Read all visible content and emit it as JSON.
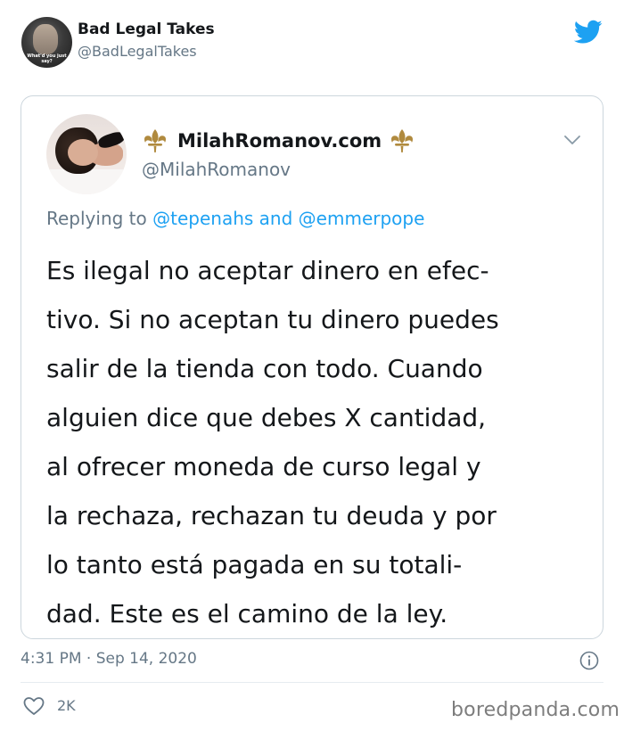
{
  "author": {
    "name": "Bad Legal Takes",
    "handle": "@BadLegalTakes",
    "avatar_caption": "What'd you just say?"
  },
  "quoted_tweet": {
    "display_name": "MilahRomanov.com",
    "handle": "@MilahRomanov",
    "replying_prefix": "Replying to",
    "mention_1": "@tepenahs",
    "replying_and": "and",
    "mention_2": "@emmerpope",
    "body_lines": [
      "Es ilegal no aceptar dinero en efec-",
      "tivo. Si no aceptan tu dinero puedes",
      "salir de la tienda con todo. Cuando",
      "alguien dice que debes X cantidad,",
      "al ofrecer moneda de curso legal y",
      "la rechaza, rechazan tu deuda y por",
      "lo tanto está pagada en su totali-",
      "dad. Este es el camino de la ley."
    ]
  },
  "footer": {
    "timestamp": "4:31 PM · Sep 14, 2020",
    "likes": "2K",
    "watermark": "boredpanda.com"
  },
  "icons": {
    "brand": "twitter-bird-icon",
    "decoration": "fleur-de-lis-icon",
    "menu": "chevron-down-icon",
    "info": "info-icon",
    "like": "heart-icon"
  },
  "colors": {
    "brand_blue": "#1da1f2",
    "muted_text": "#657786",
    "text": "#14171a",
    "border": "#ccd6dd",
    "fleur_gold": "#b08a3e"
  }
}
